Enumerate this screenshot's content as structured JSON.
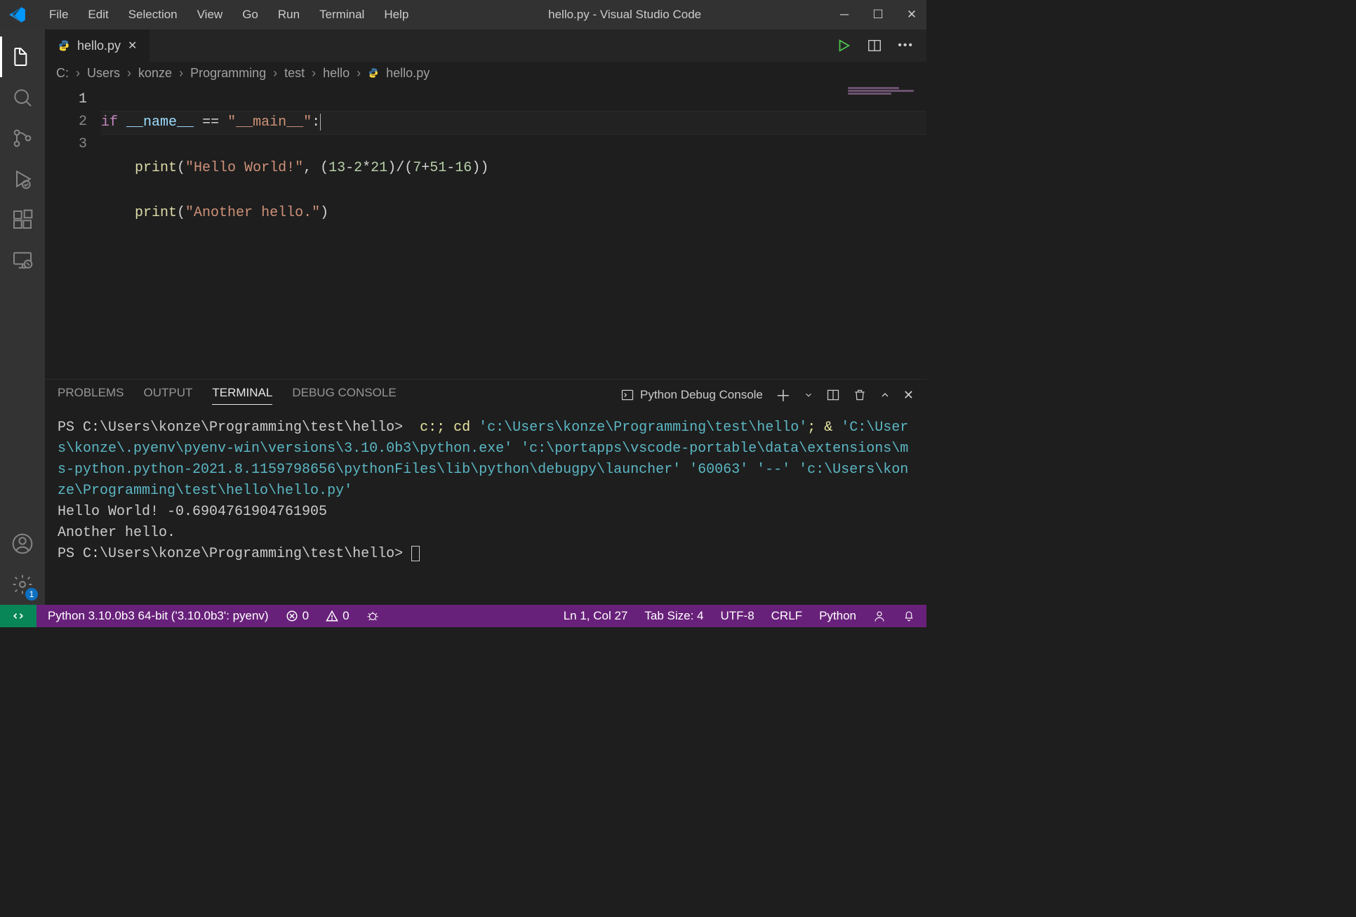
{
  "menu": {
    "file": "File",
    "edit": "Edit",
    "selection": "Selection",
    "view": "View",
    "go": "Go",
    "run": "Run",
    "terminal": "Terminal",
    "help": "Help"
  },
  "title": "hello.py - Visual Studio Code",
  "tab": {
    "filename": "hello.py"
  },
  "breadcrumb": [
    "C:",
    "Users",
    "konze",
    "Programming",
    "test",
    "hello",
    "hello.py"
  ],
  "editor": {
    "lines": [
      "1",
      "2",
      "3"
    ],
    "line1": {
      "kw": "if",
      "var": "__name__",
      "eq": "==",
      "str": "\"__main__\"",
      "colon": ":"
    },
    "line2": {
      "indent": "    ",
      "fn": "print",
      "open": "(",
      "str": "\"Hello World!\"",
      "comma": ", ",
      "p1": "(",
      "n1": "13",
      "m1": "-",
      "n2": "2",
      "star": "*",
      "n3": "21",
      "p2": ")",
      "slash": "/",
      "p3": "(",
      "n4": "7",
      "plus": "+",
      "n5": "51",
      "m2": "-",
      "n6": "16",
      "p4": ")",
      "close": ")"
    },
    "line3": {
      "indent": "    ",
      "fn": "print",
      "open": "(",
      "str": "\"Another hello.\"",
      "close": ")"
    }
  },
  "panel": {
    "tabs": {
      "problems": "PROBLEMS",
      "output": "OUTPUT",
      "terminal": "TERMINAL",
      "debug": "DEBUG CONSOLE"
    },
    "select": "Python Debug Console"
  },
  "terminal": {
    "prompt": "PS C:\\Users\\konze\\Programming\\test\\hello> ",
    "cmd1": "c:; cd ",
    "path1": "'c:\\Users\\konze\\Programming\\test\\hello'",
    "cmd2": "; & ",
    "path2": "'C:\\Users\\konze\\.pyenv\\pyenv-win\\versions\\3.10.0b3\\python.exe' 'c:\\portapps\\vscode-portable\\data\\extensions\\ms-python.python-2021.8.1159798656\\pythonFiles\\lib\\python\\debugpy\\launcher' '60063' '--' 'c:\\Users\\konze\\Programming\\test\\hello\\hello.py'",
    "out1": "Hello World! -0.6904761904761905",
    "out2": "Another hello.",
    "prompt2": "PS C:\\Users\\konze\\Programming\\test\\hello> "
  },
  "statusbar": {
    "interpreter": "Python 3.10.0b3 64-bit ('3.10.0b3': pyenv)",
    "errors": "0",
    "warnings": "0",
    "cursor": "Ln 1, Col 27",
    "tab": "Tab Size: 4",
    "encoding": "UTF-8",
    "eol": "CRLF",
    "lang": "Python"
  },
  "activity": {
    "gear_badge": "1"
  }
}
